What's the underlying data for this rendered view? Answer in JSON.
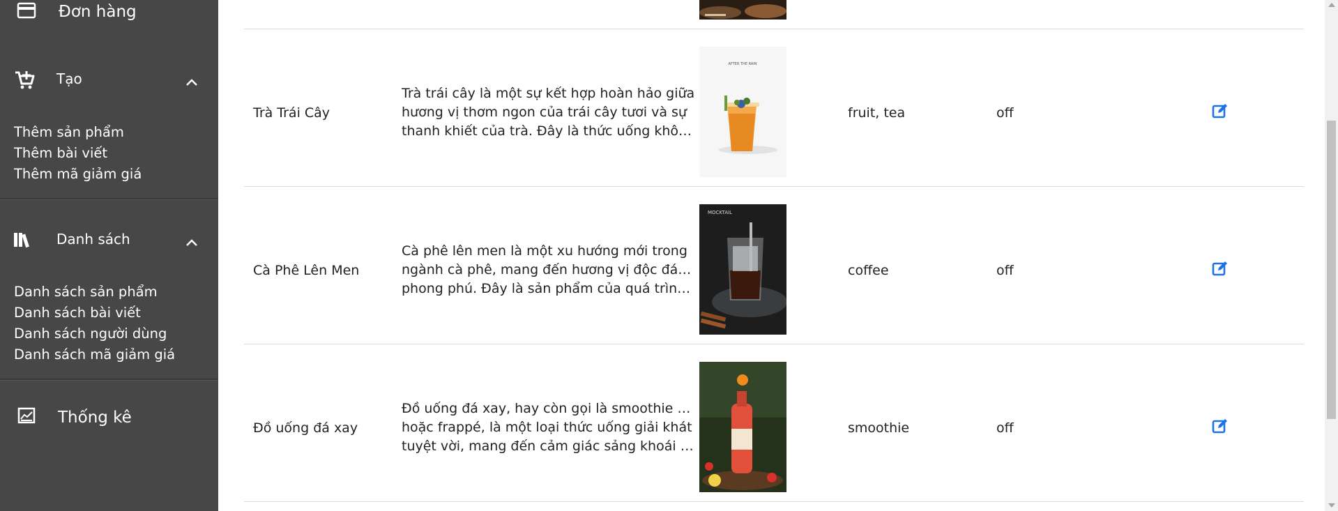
{
  "sidebar": {
    "orders_label": "Đơn hàng",
    "create": {
      "label": "Tạo",
      "items": [
        "Thêm sản phẩm",
        "Thêm bài viết",
        "Thêm mã giảm giá"
      ]
    },
    "lists": {
      "label": "Danh sách",
      "items": [
        "Danh sách sản phẩm",
        "Danh sách bài viết",
        "Danh sách người dùng",
        "Danh sách mã giảm giá"
      ]
    },
    "stats_label": "Thống kê"
  },
  "table": {
    "rows": [
      {
        "name": "Trà Trái Cây",
        "description": [
          "Trà trái cây là một sự kết hợp hoàn hảo giữa",
          "hương vị thơm ngon của trái cây tươi và sự",
          "thanh khiết của trà. Đây là thức uống không c..."
        ],
        "image_caption": "AFTER THE RAIN",
        "tags": "fruit, tea",
        "status": "off"
      },
      {
        "name": "Cà Phê Lên Men",
        "description": [
          "Cà phê lên men là một xu hướng mới trong",
          "ngành cà phê, mang đến hương vị độc đáo và",
          "phong phú. Đây là sản phẩm của quá trình lên..."
        ],
        "image_caption": "MOCKTAIL",
        "tags": "coffee",
        "status": "off"
      },
      {
        "name": "Đồ uống đá xay",
        "description": [
          "Đồ uống đá xay, hay còn gọi là smoothie đá xay",
          "hoặc frappé, là một loại thức uống giải khát",
          "tuyệt vời, mang đến cảm giác sảng khoái và tư..."
        ],
        "image_caption": "",
        "tags": "smoothie",
        "status": "off"
      }
    ]
  },
  "colors": {
    "sidebar_bg": "#474747",
    "edit_icon": "#1a73e8"
  }
}
